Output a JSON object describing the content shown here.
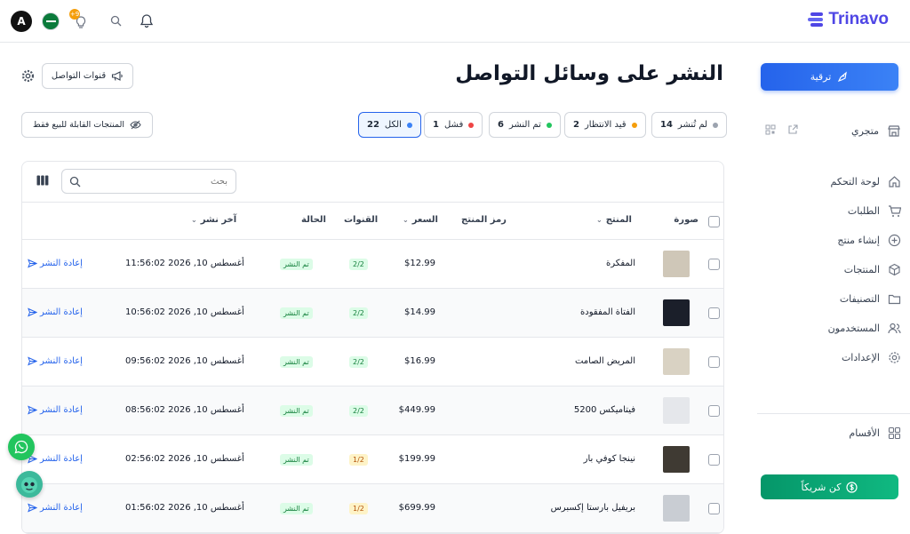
{
  "topbar": {
    "avatar_letter": "A",
    "notification_count": "+9",
    "brand": "Trinavo"
  },
  "sidebar": {
    "upgrade_label": "ترقية",
    "store_label": "متجري",
    "items": [
      {
        "label": "لوحة التحكم",
        "icon": "home-icon"
      },
      {
        "label": "الطلبات",
        "icon": "cart-icon"
      },
      {
        "label": "إنشاء منتج",
        "icon": "plus-circle-icon"
      },
      {
        "label": "المنتجات",
        "icon": "box-icon"
      },
      {
        "label": "التصنيفات",
        "icon": "folder-icon"
      },
      {
        "label": "المستخدمون",
        "icon": "users-icon"
      },
      {
        "label": "الإعدادات",
        "icon": "gear-icon"
      }
    ],
    "sections_label": "الأقسام",
    "partner_label": "كن شريكاً"
  },
  "header": {
    "title": "النشر على وسائل التواصل",
    "channels_label": "قنوات التواصل"
  },
  "filters": {
    "chips": [
      {
        "label": "لم تُنشر",
        "count": "14",
        "color": "#9ca3af"
      },
      {
        "label": "قيد الانتظار",
        "count": "2",
        "color": "#f59e0b"
      },
      {
        "label": "تم النشر",
        "count": "6",
        "color": "#22c55e"
      },
      {
        "label": "فشل",
        "count": "1",
        "color": "#ef4444"
      },
      {
        "label": "الكل",
        "count": "22",
        "color": "#3b82f6"
      }
    ],
    "sellable_label": "المنتجات القابلة للبيع فقط"
  },
  "table": {
    "search_placeholder": "بحث",
    "headers": {
      "image": "صورة",
      "product": "المنتج",
      "sku": "رمز المنتج",
      "price": "السعر",
      "channels": "القنوات",
      "status": "الحالة",
      "last_publish": "آخر نشر"
    },
    "rows": [
      {
        "product": "المفكرة",
        "price": "$12.99",
        "channels": "2/2",
        "channels_tone": "green",
        "status": "تم النشر",
        "date": "أغسطس 10, 2026 11:56:02",
        "action": "إعادة النشر",
        "thumb": "#cfc7b8"
      },
      {
        "product": "الفتاة المفقودة",
        "price": "$14.99",
        "channels": "2/2",
        "channels_tone": "green",
        "status": "تم النشر",
        "date": "أغسطس 10, 2026 10:56:02",
        "action": "إعادة النشر",
        "thumb": "#1b1f2a"
      },
      {
        "product": "المريض الصامت",
        "price": "$16.99",
        "channels": "2/2",
        "channels_tone": "green",
        "status": "تم النشر",
        "date": "أغسطس 10, 2026 09:56:02",
        "action": "إعادة النشر",
        "thumb": "#d9d2c3"
      },
      {
        "product": "فيتاميكس 5200",
        "price": "$449.99",
        "channels": "2/2",
        "channels_tone": "green",
        "status": "تم النشر",
        "date": "أغسطس 10, 2026 08:56:02",
        "action": "إعادة النشر",
        "thumb": "#e5e7eb"
      },
      {
        "product": "نينجا كوفي بار",
        "price": "$199.99",
        "channels": "1/2",
        "channels_tone": "orange",
        "status": "تم النشر",
        "date": "أغسطس 10, 2026 02:56:02",
        "action": "إعادة النشر",
        "thumb": "#3f3a33"
      },
      {
        "product": "بريفيل بارستا إكسبرس",
        "price": "$699.99",
        "channels": "1/2",
        "channels_tone": "orange",
        "status": "تم النشر",
        "date": "أغسطس 10, 2026 01:56:02",
        "action": "إعادة النشر",
        "thumb": "#c9cdd3"
      }
    ]
  }
}
